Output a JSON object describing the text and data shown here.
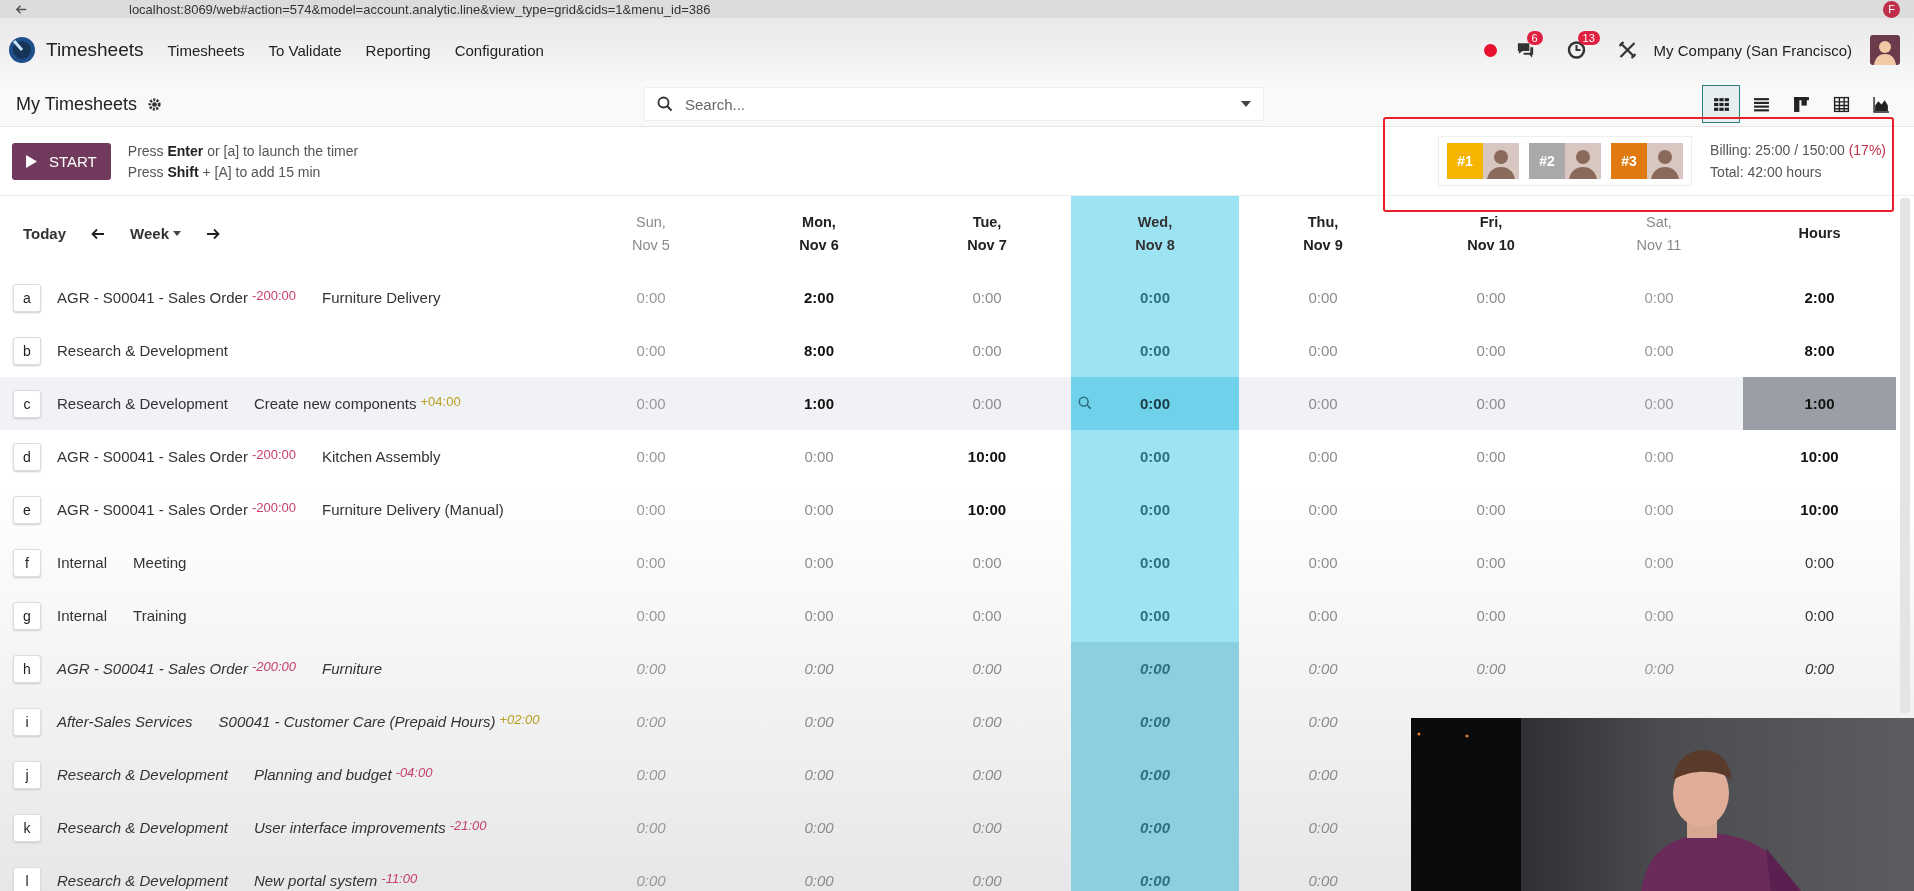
{
  "browser": {
    "url": "localhost:8069/web#action=574&model=account.analytic.line&view_type=grid&cids=1&menu_id=386",
    "profile": "F"
  },
  "navbar": {
    "app": "Timesheets",
    "menu": [
      "Timesheets",
      "To Validate",
      "Reporting",
      "Configuration"
    ],
    "chat_count": "6",
    "activity_count": "13",
    "company": "My Company (San Francisco)"
  },
  "control_panel": {
    "title": "My Timesheets",
    "search": {
      "placeholder": "Search..."
    },
    "views": [
      {
        "kind": "grid",
        "selected": true
      },
      {
        "kind": "list",
        "selected": false
      },
      {
        "kind": "kanban",
        "selected": false
      },
      {
        "kind": "pivot",
        "selected": false
      },
      {
        "kind": "graph",
        "selected": false
      }
    ]
  },
  "timer": {
    "button": "START",
    "hints": [
      "Press **Enter** or [a] to launch the timer",
      "Press **Shift** + [A] to add 15 min"
    ]
  },
  "leaderboard": [
    {
      "rank": "#1",
      "color": "#f5b400"
    },
    {
      "rank": "#2",
      "color": "#a9a9a9"
    },
    {
      "rank": "#3",
      "color": "#e07a10"
    }
  ],
  "billing": {
    "text": "Billing: 25:00 / 150:00",
    "percent": "(17%)",
    "total": "Total: 42:00 hours"
  },
  "navigation": {
    "today": "Today",
    "range": "Week"
  },
  "days": [
    {
      "day": "Sun,",
      "date": "Nov 5",
      "weekend": true,
      "today": false
    },
    {
      "day": "Mon,",
      "date": "Nov 6",
      "weekend": false,
      "today": false
    },
    {
      "day": "Tue,",
      "date": "Nov 7",
      "weekend": false,
      "today": false
    },
    {
      "day": "Wed,",
      "date": "Nov 8",
      "weekend": false,
      "today": true
    },
    {
      "day": "Thu,",
      "date": "Nov 9",
      "weekend": false,
      "today": false
    },
    {
      "day": "Fri,",
      "date": "Nov 10",
      "weekend": false,
      "today": false
    },
    {
      "day": "Sat,",
      "date": "Nov 11",
      "weekend": true,
      "today": false
    }
  ],
  "total_heading": "Hours",
  "rows": [
    {
      "key": "a",
      "kind": "existing",
      "hovered": false,
      "project": {
        "text": "AGR - S00041 - Sales Order",
        "badge": {
          "text": "-200:00",
          "color": "#c8406a"
        }
      },
      "task": {
        "text": "Furniture Delivery"
      },
      "cells": [
        {
          "value": "0:00",
          "empty": true
        },
        {
          "value": "2:00",
          "empty": false
        },
        {
          "value": "0:00",
          "empty": true
        },
        {
          "value": "0:00",
          "empty": true
        },
        {
          "value": "0:00",
          "empty": true
        },
        {
          "value": "0:00",
          "empty": true
        },
        {
          "value": "0:00",
          "empty": true
        }
      ],
      "total": {
        "value": "2:00",
        "empty": false
      }
    },
    {
      "key": "b",
      "kind": "existing",
      "hovered": false,
      "project": {
        "text": "Research & Development"
      },
      "cells": [
        {
          "value": "0:00",
          "empty": true
        },
        {
          "value": "8:00",
          "empty": false
        },
        {
          "value": "0:00",
          "empty": true
        },
        {
          "value": "0:00",
          "empty": true
        },
        {
          "value": "0:00",
          "empty": true
        },
        {
          "value": "0:00",
          "empty": true
        },
        {
          "value": "0:00",
          "empty": true
        }
      ],
      "total": {
        "value": "8:00",
        "empty": false
      }
    },
    {
      "key": "c",
      "kind": "existing",
      "hovered": true,
      "project": {
        "text": "Research & Development"
      },
      "task": {
        "text": "Create new components",
        "badge": {
          "text": "+04:00",
          "color": "#b8a020"
        }
      },
      "cells": [
        {
          "value": "0:00",
          "empty": true
        },
        {
          "value": "1:00",
          "empty": false
        },
        {
          "value": "0:00",
          "empty": true
        },
        {
          "value": "0:00",
          "empty": true
        },
        {
          "value": "0:00",
          "empty": true
        },
        {
          "value": "0:00",
          "empty": true
        },
        {
          "value": "0:00",
          "empty": true
        }
      ],
      "total": {
        "value": "1:00",
        "empty": false
      }
    },
    {
      "key": "d",
      "kind": "existing",
      "hovered": false,
      "project": {
        "text": "AGR - S00041 - Sales Order",
        "badge": {
          "text": "-200:00",
          "color": "#c8406a"
        }
      },
      "task": {
        "text": "Kitchen Assembly"
      },
      "cells": [
        {
          "value": "0:00",
          "empty": true
        },
        {
          "value": "0:00",
          "empty": true
        },
        {
          "value": "10:00",
          "empty": false
        },
        {
          "value": "0:00",
          "empty": true
        },
        {
          "value": "0:00",
          "empty": true
        },
        {
          "value": "0:00",
          "empty": true
        },
        {
          "value": "0:00",
          "empty": true
        }
      ],
      "total": {
        "value": "10:00",
        "empty": false
      }
    },
    {
      "key": "e",
      "kind": "existing",
      "hovered": false,
      "project": {
        "text": "AGR - S00041 - Sales Order",
        "badge": {
          "text": "-200:00",
          "color": "#c8406a"
        }
      },
      "task": {
        "text": "Furniture Delivery (Manual)"
      },
      "cells": [
        {
          "value": "0:00",
          "empty": true
        },
        {
          "value": "0:00",
          "empty": true
        },
        {
          "value": "10:00",
          "empty": false
        },
        {
          "value": "0:00",
          "empty": true
        },
        {
          "value": "0:00",
          "empty": true
        },
        {
          "value": "0:00",
          "empty": true
        },
        {
          "value": "0:00",
          "empty": true
        }
      ],
      "total": {
        "value": "10:00",
        "empty": false
      }
    },
    {
      "key": "f",
      "kind": "existing",
      "hovered": false,
      "project": {
        "text": "Internal"
      },
      "task": {
        "text": "Meeting"
      },
      "cells": [
        {
          "value": "0:00",
          "empty": true
        },
        {
          "value": "0:00",
          "empty": true
        },
        {
          "value": "0:00",
          "empty": true
        },
        {
          "value": "0:00",
          "empty": true
        },
        {
          "value": "0:00",
          "empty": true
        },
        {
          "value": "0:00",
          "empty": true
        },
        {
          "value": "0:00",
          "empty": true
        }
      ],
      "total": {
        "value": "0:00",
        "empty": true
      }
    },
    {
      "key": "g",
      "kind": "existing",
      "hovered": false,
      "project": {
        "text": "Internal"
      },
      "task": {
        "text": "Training"
      },
      "cells": [
        {
          "value": "0:00",
          "empty": true
        },
        {
          "value": "0:00",
          "empty": true
        },
        {
          "value": "0:00",
          "empty": true
        },
        {
          "value": "0:00",
          "empty": true
        },
        {
          "value": "0:00",
          "empty": true
        },
        {
          "value": "0:00",
          "empty": true
        },
        {
          "value": "0:00",
          "empty": true
        }
      ],
      "total": {
        "value": "0:00",
        "empty": true
      }
    },
    {
      "key": "h",
      "kind": "suggested",
      "hovered": false,
      "project": {
        "text": "AGR - S00041 - Sales Order",
        "badge": {
          "text": "-200:00",
          "color": "#c8406a"
        }
      },
      "task": {
        "text": "Furniture"
      },
      "cells": [
        {
          "value": "0:00",
          "empty": true
        },
        {
          "value": "0:00",
          "empty": true
        },
        {
          "value": "0:00",
          "empty": true
        },
        {
          "value": "0:00",
          "empty": true
        },
        {
          "value": "0:00",
          "empty": true
        },
        {
          "value": "0:00",
          "empty": true
        },
        {
          "value": "0:00",
          "empty": true
        }
      ],
      "total": {
        "value": "0:00",
        "empty": true
      }
    },
    {
      "key": "i",
      "kind": "suggested",
      "hovered": false,
      "project": {
        "text": "After-Sales Services"
      },
      "task": {
        "text": "S00041 - Customer Care (Prepaid Hours)",
        "badge": {
          "text": "+02:00",
          "color": "#b8a020"
        }
      },
      "cells": [
        {
          "value": "0:00",
          "empty": true
        },
        {
          "value": "0:00",
          "empty": true
        },
        {
          "value": "0:00",
          "empty": true
        },
        {
          "value": "0:00",
          "empty": true
        },
        {
          "value": "0:00",
          "empty": true
        }
      ]
    },
    {
      "key": "j",
      "kind": "suggested",
      "hovered": false,
      "project": {
        "text": "Research & Development"
      },
      "task": {
        "text": "Planning and budget",
        "badge": {
          "text": "-04:00",
          "color": "#c8406a"
        }
      },
      "cells": [
        {
          "value": "0:00",
          "empty": true
        },
        {
          "value": "0:00",
          "empty": true
        },
        {
          "value": "0:00",
          "empty": true
        },
        {
          "value": "0:00",
          "empty": true
        },
        {
          "value": "0:00",
          "empty": true
        }
      ]
    },
    {
      "key": "k",
      "kind": "suggested",
      "hovered": false,
      "project": {
        "text": "Research & Development"
      },
      "task": {
        "text": "User interface improvements",
        "badge": {
          "text": "-21:00",
          "color": "#c8406a"
        }
      },
      "cells": [
        {
          "value": "0:00",
          "empty": true
        },
        {
          "value": "0:00",
          "empty": true
        },
        {
          "value": "0:00",
          "empty": true
        },
        {
          "value": "0:00",
          "empty": true
        },
        {
          "value": "0:00",
          "empty": true
        }
      ]
    },
    {
      "key": "l",
      "kind": "suggested",
      "hovered": false,
      "project": {
        "text": "Research & Development"
      },
      "task": {
        "text": "New portal system",
        "badge": {
          "text": "-11:00",
          "color": "#c8406a"
        }
      },
      "cells": [
        {
          "value": "0:00",
          "empty": true
        },
        {
          "value": "0:00",
          "empty": true
        },
        {
          "value": "0:00",
          "empty": true
        },
        {
          "value": "0:00",
          "empty": true
        },
        {
          "value": "0:00",
          "empty": true
        }
      ]
    }
  ]
}
